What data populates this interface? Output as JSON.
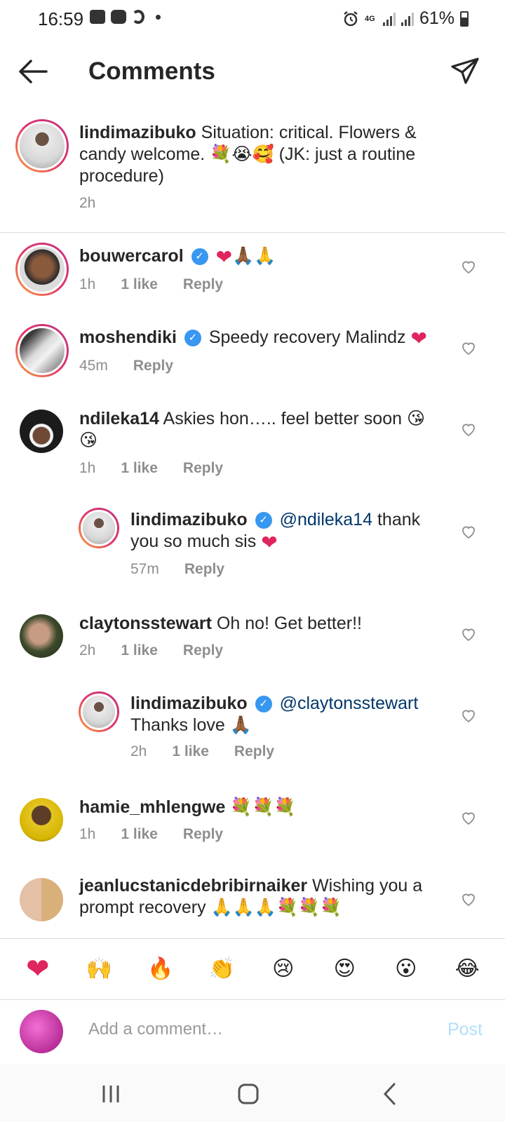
{
  "status_bar": {
    "time": "16:59",
    "network": "4G",
    "battery": "61%"
  },
  "header": {
    "title": "Comments",
    "back_icon": "arrow-left-icon",
    "share_icon": "paper-plane-icon"
  },
  "caption": {
    "username": "lindimazibuko",
    "text": "Situation: critical. Flowers & candy welcome.",
    "text_tail": "(JK: just a routine procedure)",
    "time": "2h"
  },
  "comments": [
    {
      "username": "bouwercarol",
      "verified": true,
      "text": "",
      "time": "1h",
      "likes": "1 like",
      "reply": "Reply"
    },
    {
      "username": "moshendiki",
      "verified": true,
      "text": "Speedy recovery Malindz",
      "time": "45m",
      "likes": "",
      "reply": "Reply"
    },
    {
      "username": "ndileka14",
      "verified": false,
      "text": "Askies hon….. feel better soon",
      "time": "1h",
      "likes": "1 like",
      "reply": "Reply"
    },
    {
      "username": "lindimazibuko",
      "verified": true,
      "mention": "@ndileka14",
      "text": "thank you so much sis",
      "time": "57m",
      "likes": "",
      "reply": "Reply"
    },
    {
      "username": "claytonsstewart",
      "verified": false,
      "text": "Oh no! Get better!!",
      "time": "2h",
      "likes": "1 like",
      "reply": "Reply"
    },
    {
      "username": "lindimazibuko",
      "verified": true,
      "mention": "@claytonsstewart",
      "text": "Thanks love",
      "time": "2h",
      "likes": "1 like",
      "reply": "Reply"
    },
    {
      "username": "hamie_mhlengwe",
      "verified": false,
      "text": "",
      "time": "1h",
      "likes": "1 like",
      "reply": "Reply"
    },
    {
      "username": "jeanlucstanicdebribirnaiker",
      "verified": false,
      "text": "Wishing you a prompt recovery",
      "time": "",
      "likes": "",
      "reply": ""
    }
  ],
  "reactions": [
    "red-heart",
    "raising-hands",
    "fire",
    "clapping-hands",
    "crying-face",
    "heart-eyes-face",
    "surprised-face",
    "tears-of-joy-face"
  ],
  "composer": {
    "placeholder": "Add a comment…",
    "post_label": "Post"
  },
  "colors": {
    "link": "#00376b",
    "verified": "#3897f0",
    "post_disabled": "#b2dffc",
    "heart": "#e0245e"
  }
}
